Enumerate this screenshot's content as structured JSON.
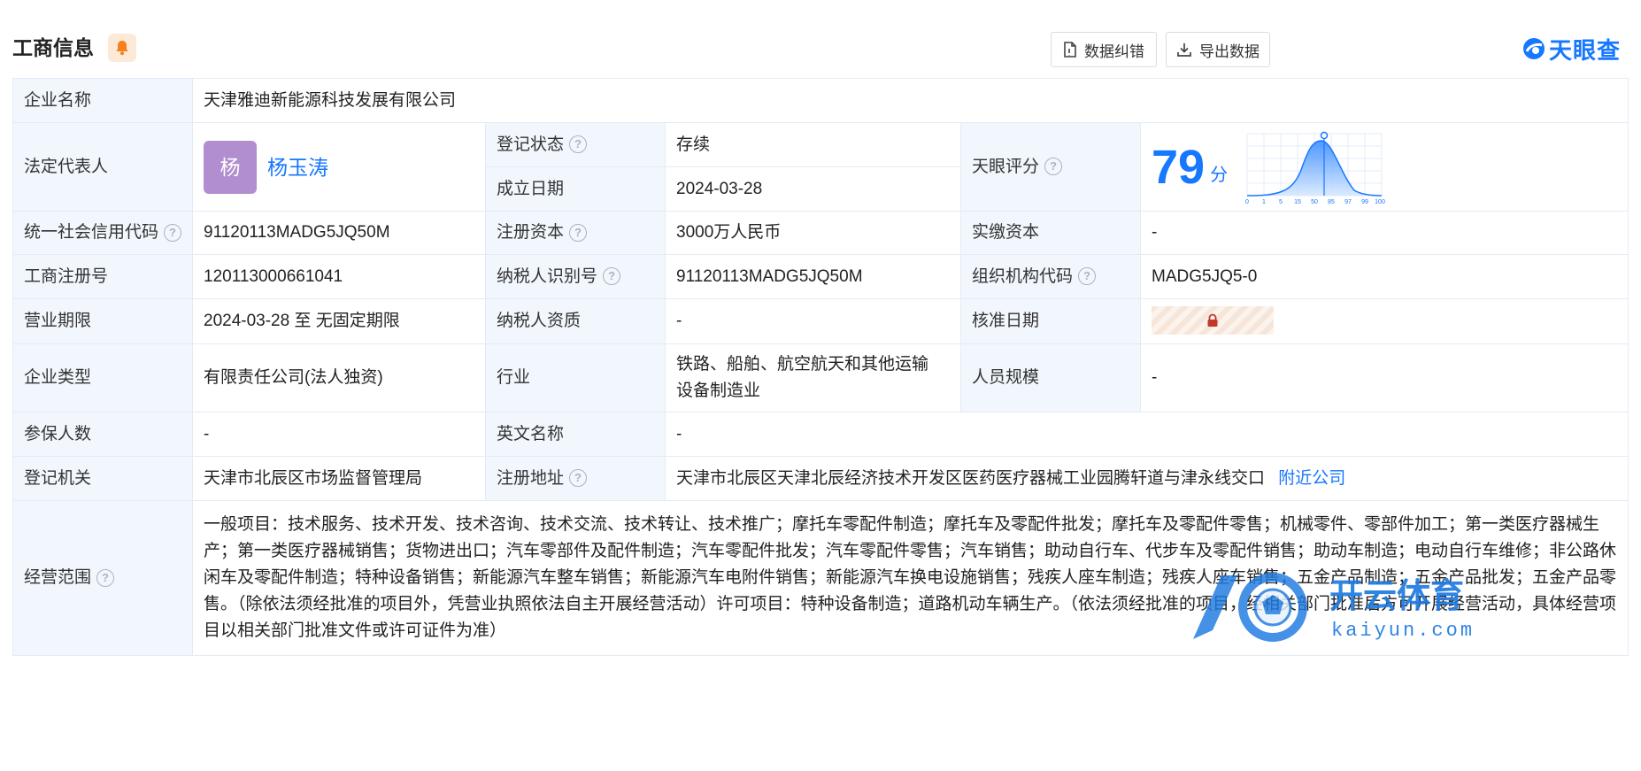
{
  "header": {
    "title": "工商信息",
    "icon": "bell-icon",
    "buttons": {
      "correct_label": "数据纠错",
      "export_label": "导出数据"
    },
    "logo_text": "天眼查",
    "accent": "#1677ff"
  },
  "company": {
    "name_label": "企业名称",
    "name_value": "天津雅迪新能源科技发展有限公司",
    "legal_rep_label": "法定代表人",
    "legal_rep_avatar": "杨",
    "legal_rep_name": "杨玉涛",
    "status_label": "登记状态",
    "status_value": "存续",
    "found_date_label": "成立日期",
    "found_date_value": "2024-03-28",
    "score_label": "天眼评分",
    "score_value": "79",
    "score_unit": "分",
    "score_axis": [
      "0",
      "1",
      "5",
      "15",
      "50",
      "85",
      "97",
      "99",
      "100"
    ],
    "credit_code_label": "统一社会信用代码",
    "credit_code_value": "91120113MADG5JQ50M",
    "reg_capital_label": "注册资本",
    "reg_capital_value": "3000万人民币",
    "paid_capital_label": "实缴资本",
    "paid_capital_value": "-",
    "reg_no_label": "工商注册号",
    "reg_no_value": "120113000661041",
    "taxpayer_id_label": "纳税人识别号",
    "taxpayer_id_value": "91120113MADG5JQ50M",
    "org_code_label": "组织机构代码",
    "org_code_value": "MADG5JQ5-0",
    "term_label": "营业期限",
    "term_value": "2024-03-28 至 无固定期限",
    "taxpayer_qual_label": "纳税人资质",
    "taxpayer_qual_value": "-",
    "approve_date_label": "核准日期",
    "type_label": "企业类型",
    "type_value": "有限责任公司(法人独资)",
    "industry_label": "行业",
    "industry_value": "铁路、船舶、航空航天和其他运输设备制造业",
    "staff_size_label": "人员规模",
    "staff_size_value": "-",
    "insured_label": "参保人数",
    "insured_value": "-",
    "english_name_label": "英文名称",
    "english_name_value": "-",
    "authority_label": "登记机关",
    "authority_value": "天津市北辰区市场监督管理局",
    "address_label": "注册地址",
    "address_value": "天津市北辰区天津北辰经济技术开发区医药医疗器械工业园腾轩道与津永线交口",
    "nearby_link": "附近公司",
    "scope_label": "经营范围",
    "scope_value": "一般项目：技术服务、技术开发、技术咨询、技术交流、技术转让、技术推广；摩托车零配件制造；摩托车及零配件批发；摩托车及零配件零售；机械零件、零部件加工；第一类医疗器械生产；第一类医疗器械销售；货物进出口；汽车零部件及配件制造；汽车零配件批发；汽车零配件零售；汽车销售；助动自行车、代步车及零配件销售；助动车制造；电动自行车维修；非公路休闲车及零配件制造；特种设备销售；新能源汽车整车销售；新能源汽车电附件销售；新能源汽车换电设施销售；残疾人座车制造；残疾人座车销售；五金产品制造；五金产品批发；五金产品零售。（除依法须经批准的项目外，凭营业执照依法自主开展经营活动）许可项目：特种设备制造；道路机动车辆生产。（依法须经批准的项目，经相关部门批准后方可开展经营活动，具体经营项目以相关部门批准文件或许可证件为准）"
  },
  "watermark": {
    "brand_text": "开云体育",
    "domain_text": "kaiyun.com"
  }
}
